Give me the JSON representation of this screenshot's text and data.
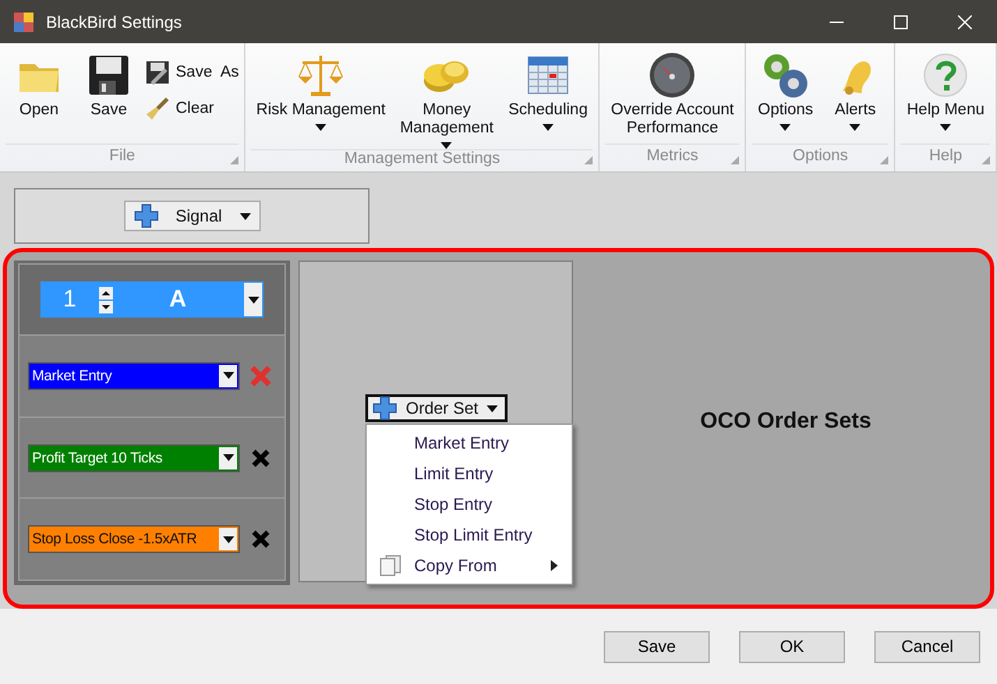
{
  "window": {
    "title": "BlackBird Settings"
  },
  "ribbon": {
    "groups": [
      {
        "label": "File",
        "items": [
          {
            "kind": "large",
            "label": "Open",
            "dropdown": false
          },
          {
            "kind": "large",
            "label": "Save",
            "dropdown": false
          },
          {
            "kind": "small",
            "label": "Save  As",
            "dropdown": false
          },
          {
            "kind": "small",
            "label": "Clear",
            "dropdown": false
          }
        ]
      },
      {
        "label": "Management Settings",
        "items": [
          {
            "kind": "large",
            "label": "Risk Management",
            "dropdown": true
          },
          {
            "kind": "large",
            "label": "Money Management",
            "dropdown": true
          },
          {
            "kind": "large",
            "label": "Scheduling",
            "dropdown": true
          }
        ]
      },
      {
        "label": "Metrics",
        "items": [
          {
            "kind": "large",
            "label": "Override Account Performance",
            "dropdown": false
          }
        ]
      },
      {
        "label": "Options",
        "items": [
          {
            "kind": "large",
            "label": "Options",
            "dropdown": true
          },
          {
            "kind": "large",
            "label": "Alerts",
            "dropdown": true
          }
        ]
      },
      {
        "label": "Help",
        "items": [
          {
            "kind": "large",
            "label": "Help Menu",
            "dropdown": true
          }
        ]
      }
    ]
  },
  "signal_button": {
    "label": "Signal"
  },
  "order_set_panel": {
    "number": "1",
    "letter": "A",
    "orders": [
      {
        "label": "Market Entry",
        "color": "#0000ff",
        "delete_highlighted": true
      },
      {
        "label": "Profit Target 10 Ticks",
        "color": "#008000",
        "delete_highlighted": false
      },
      {
        "label": "Stop Loss Close -1.5xATR",
        "color": "#ff8000",
        "delete_highlighted": false
      }
    ]
  },
  "order_set_button": {
    "label": "Order Set"
  },
  "order_set_menu": [
    {
      "label": "Market Entry",
      "kind": "plain"
    },
    {
      "label": "Limit Entry",
      "kind": "plain"
    },
    {
      "label": "Stop Entry",
      "kind": "plain"
    },
    {
      "label": "Stop Limit Entry",
      "kind": "plain"
    },
    {
      "label": "Copy From",
      "kind": "submenu"
    }
  ],
  "caption": "OCO Order Sets",
  "buttons": [
    "Save",
    "OK",
    "Cancel"
  ]
}
